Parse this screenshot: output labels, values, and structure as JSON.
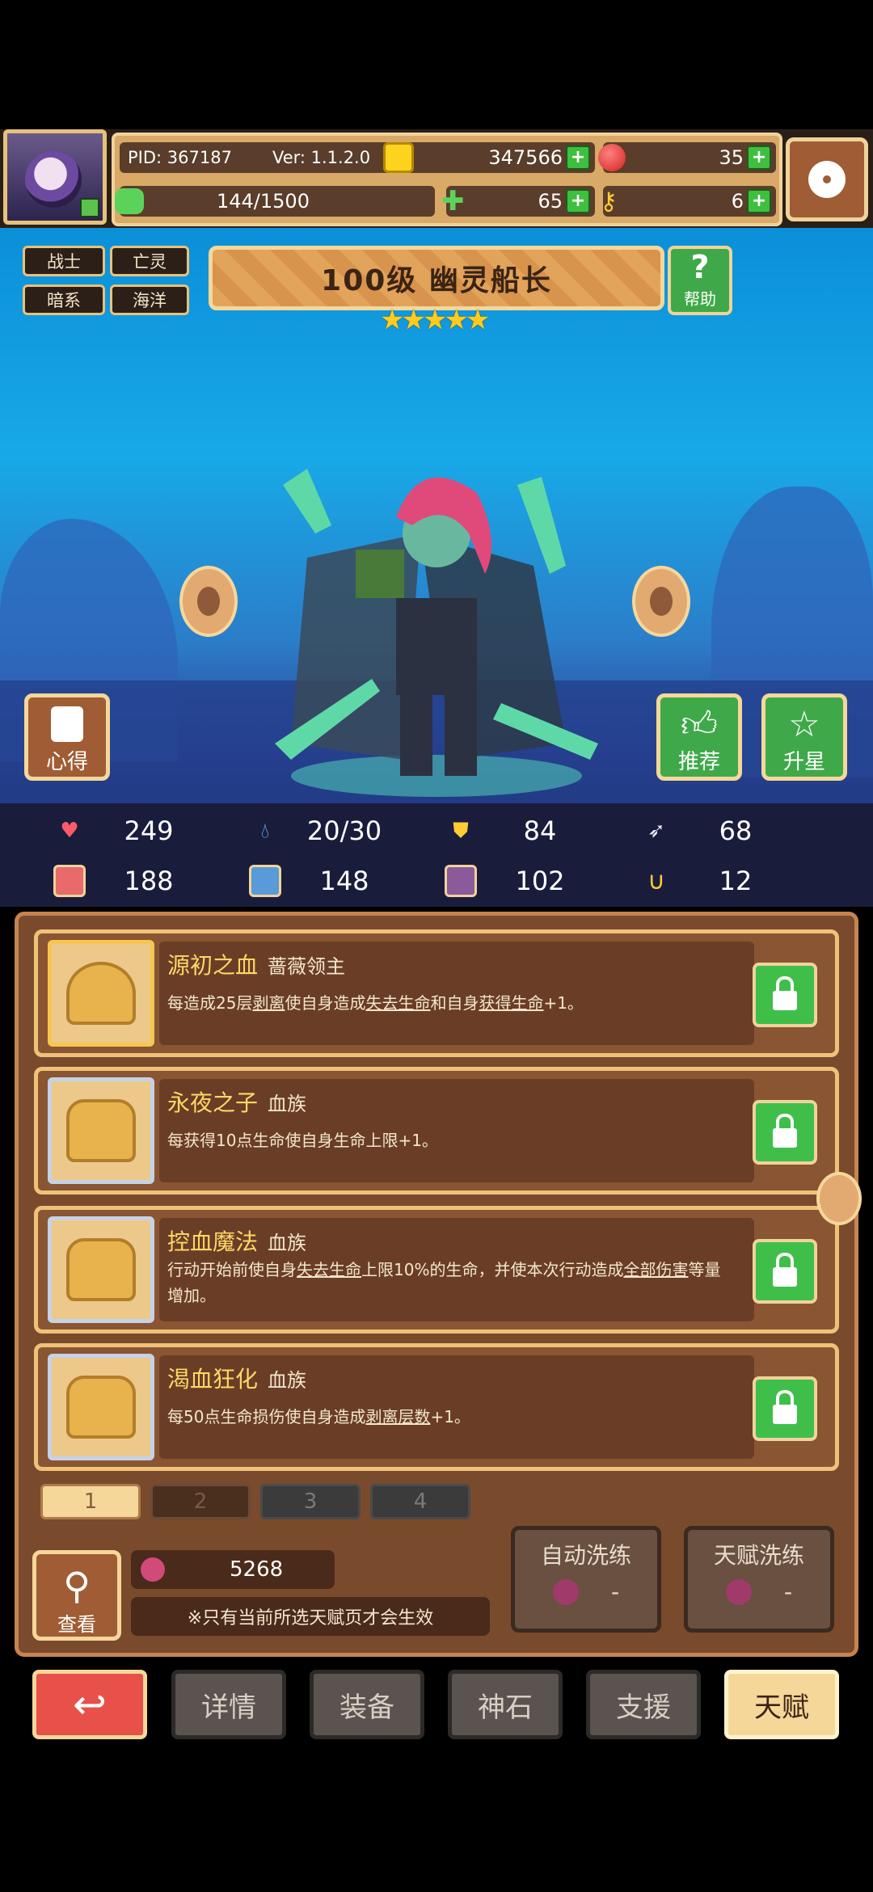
{
  "player": {
    "pid": "PID: 367187",
    "version": "Ver: 1.1.2.0",
    "exp": "144/1500"
  },
  "currency": {
    "gold": "347566",
    "gems": "35",
    "clover": "65",
    "key": "6"
  },
  "tags": [
    "战士",
    "亡灵",
    "暗系",
    "海洋"
  ],
  "hero": {
    "title": "100级 幽灵船长",
    "stars": "★★★★★"
  },
  "buttons": {
    "help": "帮助",
    "notes": "心得",
    "recommend": "推荐",
    "star_up": "升星",
    "view": "查看",
    "auto_refine": "自动洗练",
    "talent_refine": "天赋洗练"
  },
  "stats": {
    "hp": "249",
    "mana": "20/30",
    "armor": "84",
    "speed": "68",
    "attack": "188",
    "magic": "148",
    "defense": "102",
    "crit": "12"
  },
  "talents": [
    {
      "name": "源初之血",
      "sub": "蔷薇领主",
      "desc_parts": [
        "每造成25层",
        "剥离",
        "使自身造成",
        "失去生命",
        "和自身",
        "获得生命",
        "+1。"
      ]
    },
    {
      "name": "永夜之子",
      "sub": "血族",
      "desc_parts": [
        "每获得10点生命使自身生命上限+1。"
      ]
    },
    {
      "name": "控血魔法",
      "sub": "血族",
      "desc_parts": [
        "行动开始前使自身",
        "失去生命",
        "上限10%的生命，并使本次行动造成",
        "全部伤害",
        "等量增加。"
      ]
    },
    {
      "name": "渴血狂化",
      "sub": "血族",
      "desc_parts": [
        "每50点生命损伤使自身造成",
        "剥离层数",
        "+1。"
      ]
    }
  ],
  "pages": [
    "1",
    "2",
    "3",
    "4"
  ],
  "resource": {
    "amount": "5268",
    "note": "※只有当前所选天赋页才会生效",
    "auto_cost": "-",
    "talent_cost": "-"
  },
  "nav": [
    "详情",
    "装备",
    "神石",
    "支援",
    "天赋"
  ],
  "colors": {
    "active_tab": "#f6d79a",
    "back_button": "#e8504a",
    "lock_green": "#3fbf4a"
  }
}
